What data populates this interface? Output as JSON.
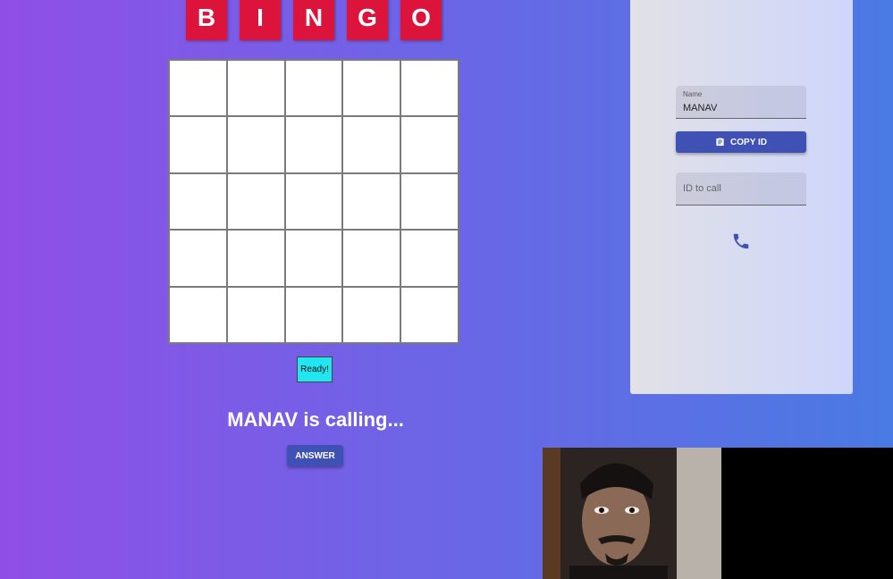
{
  "game": {
    "letters": [
      "B",
      "I",
      "N",
      "G",
      "O"
    ],
    "ready_label": "Ready!",
    "calling_text": "MANAV is calling...",
    "answer_label": "ANSWER"
  },
  "panel": {
    "name_label": "Name",
    "name_value": "MANAV",
    "copy_id_label": "COPY ID",
    "id_placeholder": "ID to call"
  },
  "icons": {
    "clipboard": "clipboard-icon",
    "phone": "phone-icon"
  },
  "colors": {
    "letter_bg": "#dc143c",
    "button_bg": "#3f51b5",
    "ready_bg": "#22e6ef"
  }
}
